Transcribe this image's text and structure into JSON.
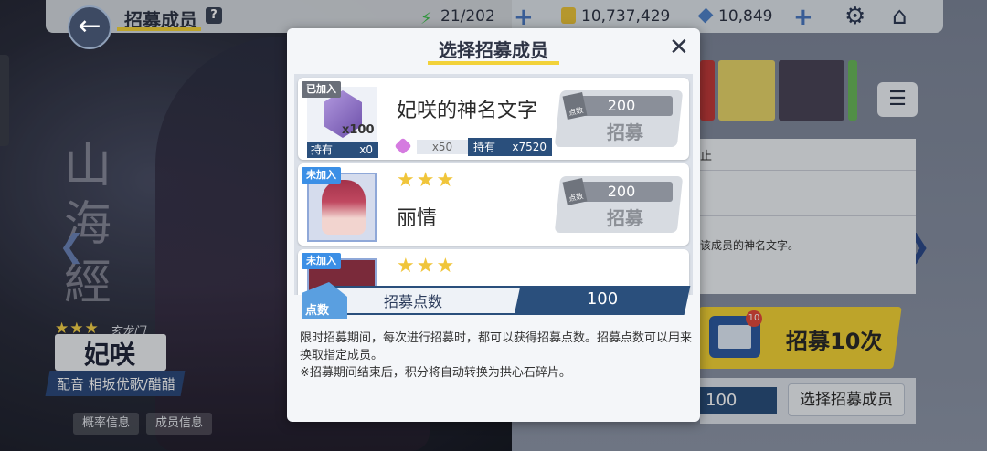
{
  "header": {
    "title": "招募成员",
    "help": "?",
    "stamina": "21/202",
    "coins": "10,737,429",
    "gems": "10,849"
  },
  "character": {
    "affiliation": "玄龙门",
    "name": "妃咲",
    "cv": "配音 相坂优歌/醋醋",
    "stars": "★★★",
    "calligraphy": "山海經",
    "buttons": [
      "概率信息",
      "成员信息"
    ]
  },
  "right_panel": {
    "line1": "止",
    "line2": "该成员的神名文字。",
    "recruit10": "招募10次",
    "recruit10_badge": "10",
    "points": "100",
    "select_button": "选择招募成员"
  },
  "modal": {
    "title": "选择招募成员",
    "cards": [
      {
        "tag": "已加入",
        "name": "妃咲的神名文字",
        "shard_count": "x100",
        "hold_label": "持有",
        "hold_value": "x0",
        "cost": "x50",
        "owned_label": "持有",
        "owned_value": "x7520",
        "points": "200",
        "button": "招募"
      },
      {
        "tag": "未加入",
        "stars": "★★★",
        "name": "丽情",
        "points": "200",
        "button": "招募"
      },
      {
        "tag": "未加入",
        "stars": "★★★"
      }
    ],
    "points_icon": "点数",
    "points_label": "招募点数",
    "points_value": "100",
    "description_1": "限时招募期间，每次进行招募时，都可以获得招募点数。招募点数可以用来换取指定成员。",
    "description_2": "※招募期间结束后，积分将自动转换为拱心石碎片。"
  },
  "colors": {
    "accent_yellow": "#f2d23a",
    "navy": "#2a4f7c"
  }
}
